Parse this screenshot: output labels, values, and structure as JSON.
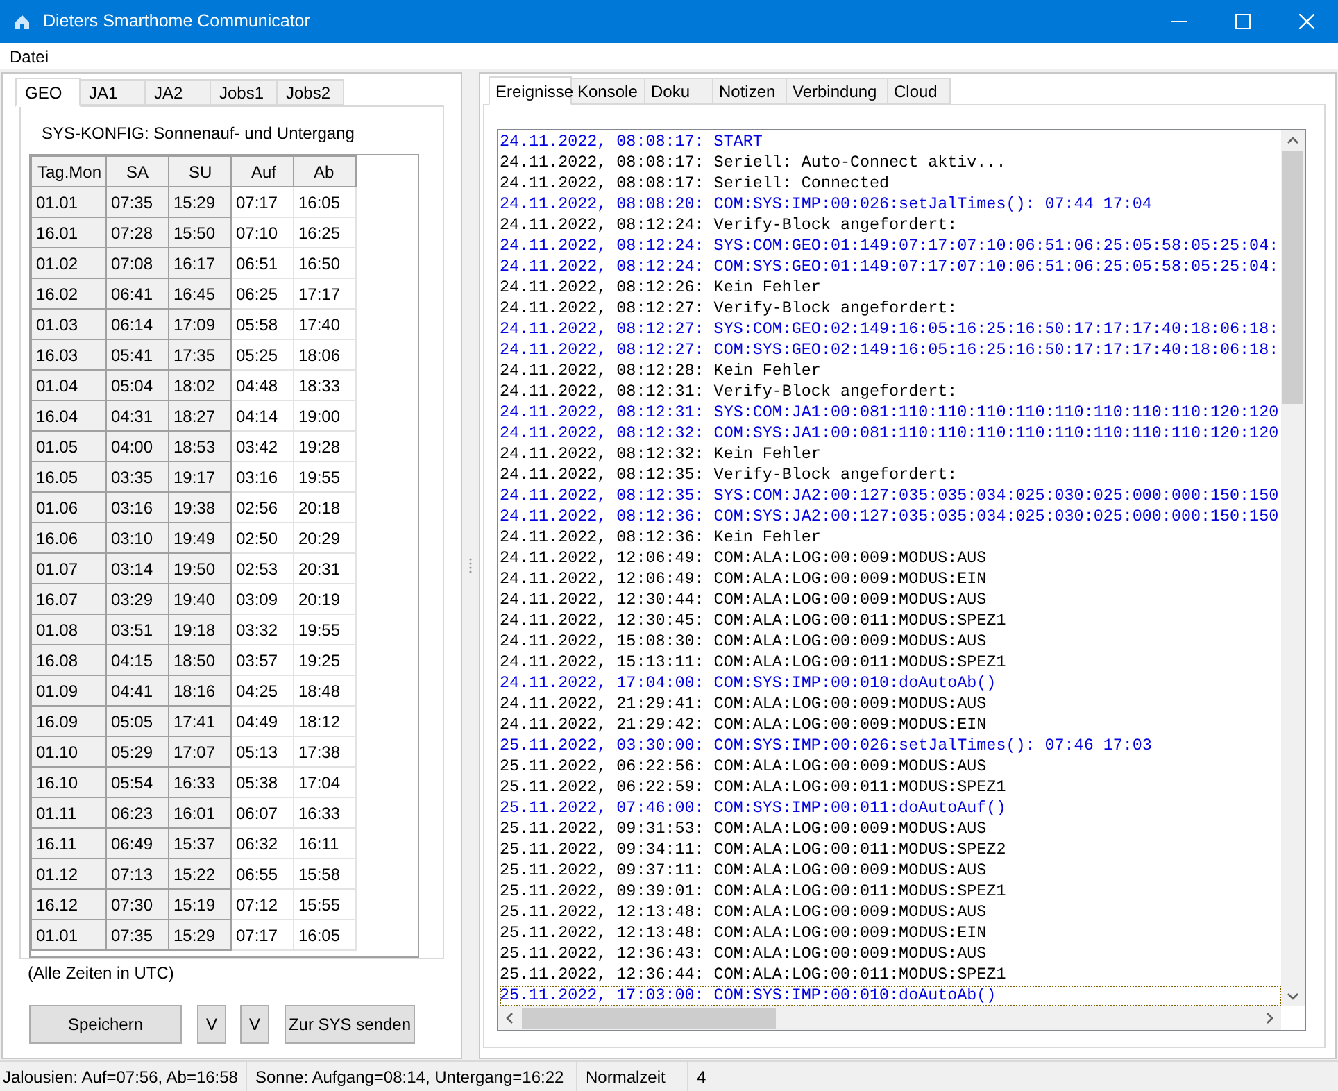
{
  "window": {
    "title": "Dieters Smarthome Communicator"
  },
  "menu": [
    "Datei"
  ],
  "left_tabs": [
    {
      "label": "GEO",
      "selected": true
    },
    {
      "label": "JA1",
      "selected": false
    },
    {
      "label": "JA2",
      "selected": false
    },
    {
      "label": "Jobs1",
      "selected": false
    },
    {
      "label": "Jobs2",
      "selected": false
    }
  ],
  "geo": {
    "heading": "SYS-KONFIG: Sonnenauf- und Untergang",
    "columns": [
      "Tag.Mon",
      "SA",
      "SU",
      "Auf",
      "Ab"
    ],
    "rows": [
      [
        "01.01",
        "07:35",
        "15:29",
        "07:17",
        "16:05"
      ],
      [
        "16.01",
        "07:28",
        "15:50",
        "07:10",
        "16:25"
      ],
      [
        "01.02",
        "07:08",
        "16:17",
        "06:51",
        "16:50"
      ],
      [
        "16.02",
        "06:41",
        "16:45",
        "06:25",
        "17:17"
      ],
      [
        "01.03",
        "06:14",
        "17:09",
        "05:58",
        "17:40"
      ],
      [
        "16.03",
        "05:41",
        "17:35",
        "05:25",
        "18:06"
      ],
      [
        "01.04",
        "05:04",
        "18:02",
        "04:48",
        "18:33"
      ],
      [
        "16.04",
        "04:31",
        "18:27",
        "04:14",
        "19:00"
      ],
      [
        "01.05",
        "04:00",
        "18:53",
        "03:42",
        "19:28"
      ],
      [
        "16.05",
        "03:35",
        "19:17",
        "03:16",
        "19:55"
      ],
      [
        "01.06",
        "03:16",
        "19:38",
        "02:56",
        "20:18"
      ],
      [
        "16.06",
        "03:10",
        "19:49",
        "02:50",
        "20:29"
      ],
      [
        "01.07",
        "03:14",
        "19:50",
        "02:53",
        "20:31"
      ],
      [
        "16.07",
        "03:29",
        "19:40",
        "03:09",
        "20:19"
      ],
      [
        "01.08",
        "03:51",
        "19:18",
        "03:32",
        "19:55"
      ],
      [
        "16.08",
        "04:15",
        "18:50",
        "03:57",
        "19:25"
      ],
      [
        "01.09",
        "04:41",
        "18:16",
        "04:25",
        "18:48"
      ],
      [
        "16.09",
        "05:05",
        "17:41",
        "04:49",
        "18:12"
      ],
      [
        "01.10",
        "05:29",
        "17:07",
        "05:13",
        "17:38"
      ],
      [
        "16.10",
        "05:54",
        "16:33",
        "05:38",
        "17:04"
      ],
      [
        "01.11",
        "06:23",
        "16:01",
        "06:07",
        "16:33"
      ],
      [
        "16.11",
        "06:49",
        "15:37",
        "06:32",
        "16:11"
      ],
      [
        "01.12",
        "07:13",
        "15:22",
        "06:55",
        "15:58"
      ],
      [
        "16.12",
        "07:30",
        "15:19",
        "07:12",
        "15:55"
      ],
      [
        "01.01",
        "07:35",
        "15:29",
        "07:17",
        "16:05"
      ]
    ],
    "note": "(Alle Zeiten in UTC)"
  },
  "buttons": [
    "Speichern",
    "V",
    "V",
    "Zur SYS senden"
  ],
  "right_tabs": [
    {
      "label": "Ereignisse",
      "selected": true
    },
    {
      "label": "Konsole",
      "selected": false
    },
    {
      "label": "Doku",
      "selected": false
    },
    {
      "label": "Notizen",
      "selected": false
    },
    {
      "label": "Verbindung",
      "selected": false
    },
    {
      "label": "Cloud",
      "selected": false
    }
  ],
  "log": [
    {
      "text": "24.11.2022, 08:08:17: START",
      "kind": "sys",
      "selected": false
    },
    {
      "text": "24.11.2022, 08:08:17: Seriell: Auto-Connect aktiv...",
      "kind": "info",
      "selected": false
    },
    {
      "text": "24.11.2022, 08:08:17: Seriell: Connected",
      "kind": "info",
      "selected": false
    },
    {
      "text": "24.11.2022, 08:08:20: COM:SYS:IMP:00:026:setJalTimes(): 07:44 17:04",
      "kind": "sys",
      "selected": false
    },
    {
      "text": "24.11.2022, 08:12:24: Verify-Block angefordert:",
      "kind": "info",
      "selected": false
    },
    {
      "text": "24.11.2022, 08:12:24: SYS:COM:GEO:01:149:07:17:07:10:06:51:06:25:05:58:05:25:04:",
      "kind": "sys",
      "selected": false
    },
    {
      "text": "24.11.2022, 08:12:24: COM:SYS:GEO:01:149:07:17:07:10:06:51:06:25:05:58:05:25:04:",
      "kind": "sys",
      "selected": false
    },
    {
      "text": "24.11.2022, 08:12:26: Kein Fehler",
      "kind": "info",
      "selected": false
    },
    {
      "text": "24.11.2022, 08:12:27: Verify-Block angefordert:",
      "kind": "info",
      "selected": false
    },
    {
      "text": "24.11.2022, 08:12:27: SYS:COM:GEO:02:149:16:05:16:25:16:50:17:17:17:40:18:06:18:",
      "kind": "sys",
      "selected": false
    },
    {
      "text": "24.11.2022, 08:12:27: COM:SYS:GEO:02:149:16:05:16:25:16:50:17:17:17:40:18:06:18:",
      "kind": "sys",
      "selected": false
    },
    {
      "text": "24.11.2022, 08:12:28: Kein Fehler",
      "kind": "info",
      "selected": false
    },
    {
      "text": "24.11.2022, 08:12:31: Verify-Block angefordert:",
      "kind": "info",
      "selected": false
    },
    {
      "text": "24.11.2022, 08:12:31: SYS:COM:JA1:00:081:110:110:110:110:110:110:110:110:120:120",
      "kind": "sys",
      "selected": false
    },
    {
      "text": "24.11.2022, 08:12:32: COM:SYS:JA1:00:081:110:110:110:110:110:110:110:110:120:120",
      "kind": "sys",
      "selected": false
    },
    {
      "text": "24.11.2022, 08:12:32: Kein Fehler",
      "kind": "info",
      "selected": false
    },
    {
      "text": "24.11.2022, 08:12:35: Verify-Block angefordert:",
      "kind": "info",
      "selected": false
    },
    {
      "text": "24.11.2022, 08:12:35: SYS:COM:JA2:00:127:035:035:034:025:030:025:000:000:150:150",
      "kind": "sys",
      "selected": false
    },
    {
      "text": "24.11.2022, 08:12:36: COM:SYS:JA2:00:127:035:035:034:025:030:025:000:000:150:150",
      "kind": "sys",
      "selected": false
    },
    {
      "text": "24.11.2022, 08:12:36: Kein Fehler",
      "kind": "info",
      "selected": false
    },
    {
      "text": "24.11.2022, 12:06:49: COM:ALA:LOG:00:009:MODUS:AUS",
      "kind": "info",
      "selected": false
    },
    {
      "text": "24.11.2022, 12:06:49: COM:ALA:LOG:00:009:MODUS:EIN",
      "kind": "info",
      "selected": false
    },
    {
      "text": "24.11.2022, 12:30:44: COM:ALA:LOG:00:009:MODUS:AUS",
      "kind": "info",
      "selected": false
    },
    {
      "text": "24.11.2022, 12:30:45: COM:ALA:LOG:00:011:MODUS:SPEZ1",
      "kind": "info",
      "selected": false
    },
    {
      "text": "24.11.2022, 15:08:30: COM:ALA:LOG:00:009:MODUS:AUS",
      "kind": "info",
      "selected": false
    },
    {
      "text": "24.11.2022, 15:13:11: COM:ALA:LOG:00:011:MODUS:SPEZ1",
      "kind": "info",
      "selected": false
    },
    {
      "text": "24.11.2022, 17:04:00: COM:SYS:IMP:00:010:doAutoAb()",
      "kind": "sys",
      "selected": false
    },
    {
      "text": "24.11.2022, 21:29:41: COM:ALA:LOG:00:009:MODUS:AUS",
      "kind": "info",
      "selected": false
    },
    {
      "text": "24.11.2022, 21:29:42: COM:ALA:LOG:00:009:MODUS:EIN",
      "kind": "info",
      "selected": false
    },
    {
      "text": "25.11.2022, 03:30:00: COM:SYS:IMP:00:026:setJalTimes(): 07:46 17:03",
      "kind": "sys",
      "selected": false
    },
    {
      "text": "25.11.2022, 06:22:56: COM:ALA:LOG:00:009:MODUS:AUS",
      "kind": "info",
      "selected": false
    },
    {
      "text": "25.11.2022, 06:22:59: COM:ALA:LOG:00:011:MODUS:SPEZ1",
      "kind": "info",
      "selected": false
    },
    {
      "text": "25.11.2022, 07:46:00: COM:SYS:IMP:00:011:doAutoAuf()",
      "kind": "sys",
      "selected": false
    },
    {
      "text": "25.11.2022, 09:31:53: COM:ALA:LOG:00:009:MODUS:AUS",
      "kind": "info",
      "selected": false
    },
    {
      "text": "25.11.2022, 09:34:11: COM:ALA:LOG:00:011:MODUS:SPEZ2",
      "kind": "info",
      "selected": false
    },
    {
      "text": "25.11.2022, 09:37:11: COM:ALA:LOG:00:009:MODUS:AUS",
      "kind": "info",
      "selected": false
    },
    {
      "text": "25.11.2022, 09:39:01: COM:ALA:LOG:00:011:MODUS:SPEZ1",
      "kind": "info",
      "selected": false
    },
    {
      "text": "25.11.2022, 12:13:48: COM:ALA:LOG:00:009:MODUS:AUS",
      "kind": "info",
      "selected": false
    },
    {
      "text": "25.11.2022, 12:13:48: COM:ALA:LOG:00:009:MODUS:EIN",
      "kind": "info",
      "selected": false
    },
    {
      "text": "25.11.2022, 12:36:43: COM:ALA:LOG:00:009:MODUS:AUS",
      "kind": "info",
      "selected": false
    },
    {
      "text": "25.11.2022, 12:36:44: COM:ALA:LOG:00:011:MODUS:SPEZ1",
      "kind": "info",
      "selected": false
    },
    {
      "text": "25.11.2022, 17:03:00: COM:SYS:IMP:00:010:doAutoAb()",
      "kind": "sys",
      "selected": true
    }
  ],
  "status_bar": [
    "Jalousien: Auf=07:56, Ab=16:58",
    "Sonne: Aufgang=08:14, Untergang=16:22",
    "Normalzeit",
    "4"
  ]
}
